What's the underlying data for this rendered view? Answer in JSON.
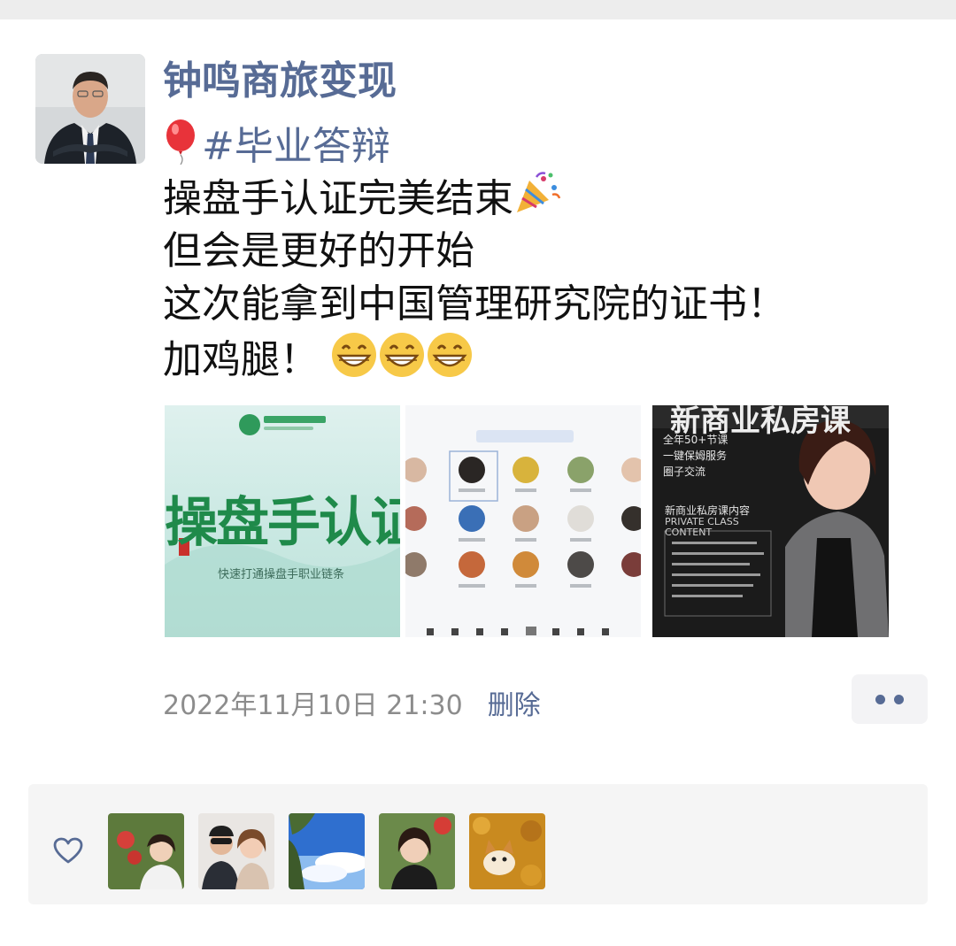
{
  "post": {
    "author": "钟鸣商旅变现",
    "emoji_balloon": "🎈",
    "hashtag": "#毕业答辩",
    "line2": "操盘手认证完美结束",
    "emoji_party": "🎉",
    "line3": "但会是更好的开始",
    "line4": "这次能拿到中国管理研究院的证书！",
    "line5": "加鸡腿！",
    "emoji_grin": "😁"
  },
  "images": {
    "img1_logo_text": "操盘手认证",
    "img1_subtitle": "快速打通操盘手职业链条",
    "img3_heading": "新商业私房课",
    "img3_points": [
      "全年50+节课",
      "一键保姆服务",
      "圈子交流"
    ],
    "img3_title": "新商业私房课内容",
    "img3_sub": "PRIVATE CLASS CONTENT"
  },
  "meta": {
    "timestamp": "2022年11月10日 21:30",
    "delete_label": "删除"
  },
  "colors": {
    "link": "#576b95",
    "timestamp": "#8c8c8c",
    "panel_bg": "#f5f5f5"
  },
  "icons": {
    "more": "more-dots-icon",
    "like": "heart-outline-icon"
  }
}
